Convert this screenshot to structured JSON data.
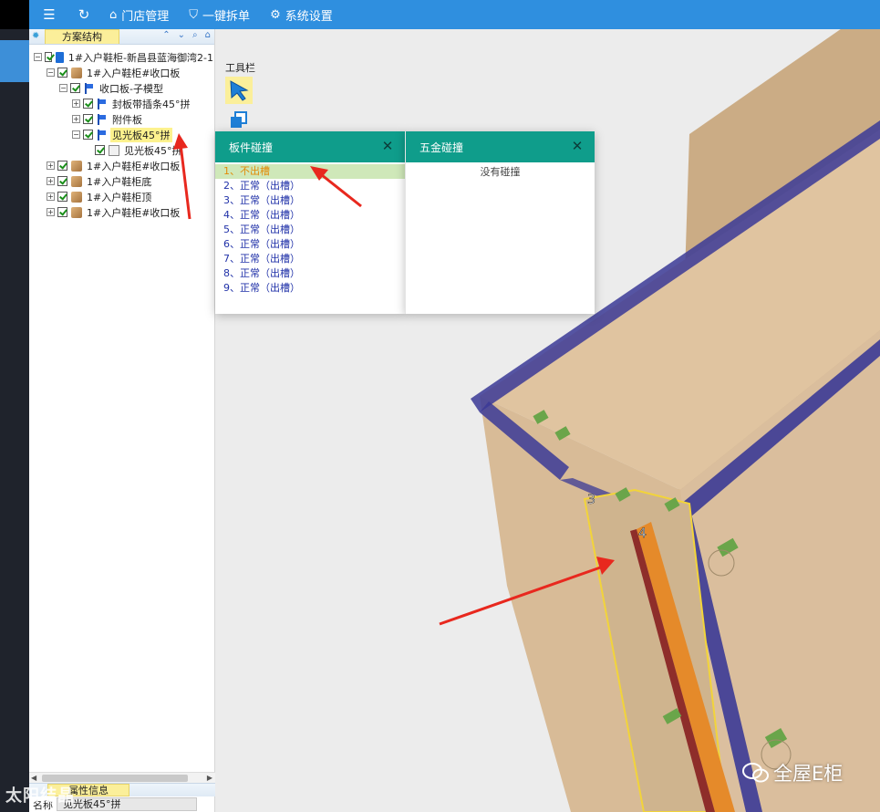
{
  "topbar": {
    "menu_icon": "menu-icon",
    "refresh_icon": "refresh-icon",
    "items": [
      {
        "label": "门店管理",
        "icon": "home-icon"
      },
      {
        "label": "一键拆单",
        "icon": "shield-check-icon"
      },
      {
        "label": "系统设置",
        "icon": "gear-icon"
      }
    ]
  },
  "tree_panel": {
    "title": "方案结构",
    "tools": [
      "expand-all-icon",
      "collapse-all-icon",
      "search-icon",
      "home-icon"
    ],
    "nodes": [
      {
        "label": "1#入户鞋柜-新昌县蓝海御湾2-1"
      },
      {
        "label": "1#入户鞋柜#收口板"
      },
      {
        "label": "收口板-子模型"
      },
      {
        "label": "封板带插条45°拼"
      },
      {
        "label": "附件板"
      },
      {
        "label": "见光板45°拼"
      },
      {
        "label": "见光板45°拼"
      },
      {
        "label": "1#入户鞋柜#收口板"
      },
      {
        "label": "1#入户鞋柜底"
      },
      {
        "label": "1#入户鞋柜顶"
      },
      {
        "label": "1#入户鞋柜#收口板"
      }
    ],
    "props": {
      "tab": "属性信息",
      "name_key": "名称",
      "name_value": "见光板45°拼"
    }
  },
  "toolbar": {
    "title": "工具栏"
  },
  "popup_board": {
    "title": "板件碰撞",
    "items": [
      "1、不出槽",
      "2、正常（出槽）",
      "3、正常（出槽）",
      "4、正常（出槽）",
      "5、正常（出槽）",
      "6、正常（出槽）",
      "7、正常（出槽）",
      "8、正常（出槽）",
      "9、正常（出槽）"
    ]
  },
  "popup_hardware": {
    "title": "五金碰撞",
    "empty": "没有碰撞"
  },
  "viewport": {
    "label_3": "3",
    "label_4": "4"
  },
  "watermarks": {
    "left": "太阳结晶",
    "right": "全屋E柜"
  },
  "colors": {
    "topbar": "#2f8fdf",
    "popup_header": "#0f9d8b",
    "selected": "#fdf28e",
    "collision_bad": "#e28b07",
    "collision_ok": "#2031a8",
    "annotation_arrow": "#e8281e"
  }
}
